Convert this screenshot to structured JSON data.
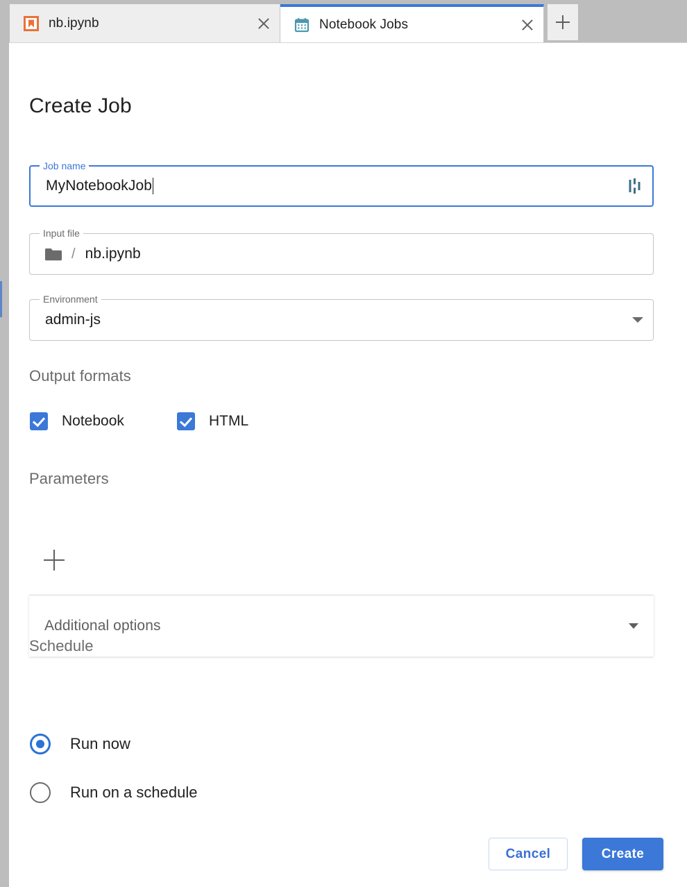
{
  "window": {
    "tabs": [
      {
        "label": "nb.ipynb",
        "icon": "notebook-file-icon",
        "active": false,
        "close_icon": "close-icon"
      },
      {
        "label": "Notebook Jobs",
        "icon": "calendar-icon",
        "active": true,
        "close_icon": "close-icon"
      }
    ],
    "new_tab_icon": "plus-icon"
  },
  "form": {
    "title": "Create Job",
    "job_name": {
      "legend": "Job name",
      "value": "MyNotebookJob",
      "placeholder": "Job name",
      "trailing_icon": "jupyterlab-icon",
      "focused": true
    },
    "input_file": {
      "legend": "Input file",
      "folder_icon": "folder-icon",
      "separator": "/",
      "value": "nb.ipynb"
    },
    "environment": {
      "legend": "Environment",
      "value": "admin-js",
      "caret_icon": "chevron-down-icon"
    },
    "output_formats": {
      "heading": "Output formats",
      "options": [
        {
          "label": "Notebook",
          "checked": true
        },
        {
          "label": "HTML",
          "checked": true
        }
      ]
    },
    "parameters": {
      "heading": "Parameters",
      "add_icon": "plus-icon"
    },
    "additional_options": {
      "label": "Additional options",
      "caret_icon": "chevron-down-icon",
      "expanded": false
    },
    "schedule": {
      "heading": "Schedule",
      "options": [
        {
          "label": "Run now",
          "selected": true
        },
        {
          "label": "Run on a schedule",
          "selected": false
        }
      ]
    },
    "actions": {
      "cancel_label": "Cancel",
      "create_label": "Create"
    }
  },
  "colors": {
    "accent_blue": "#3b78d8",
    "tab_active_bar": "#3b78d8",
    "notebook_icon_orange": "#e8733a",
    "calendar_icon_teal": "#4b98ad",
    "chrome_gray": "#bdbdbd"
  }
}
